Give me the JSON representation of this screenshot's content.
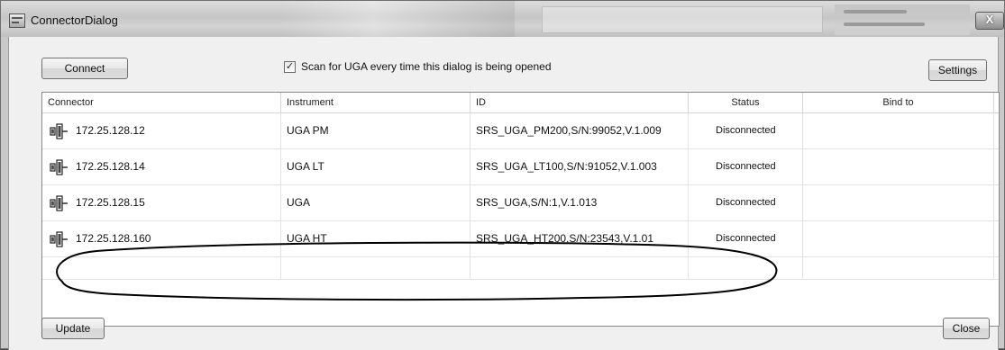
{
  "window": {
    "title": "ConnectorDialog",
    "close_glyph": "X",
    "app_icon": "dialog-app-icon"
  },
  "toolbar": {
    "connect_label": "Connect",
    "scan_checkbox_checked": true,
    "scan_label": "Scan for UGA every time this dialog is being opened",
    "settings_label": "Settings"
  },
  "table": {
    "columns": [
      "Connector",
      "Instrument",
      "ID",
      "Status",
      "Bind to"
    ],
    "rows": [
      {
        "connector": "172.25.128.12",
        "instrument": "UGA PM",
        "id": "SRS_UGA_PM200,S/N:99052,V.1.009",
        "status": "Disconnected",
        "bind_to": ""
      },
      {
        "connector": "172.25.128.14",
        "instrument": "UGA LT",
        "id": "SRS_UGA_LT100,S/N:91052,V.1.003",
        "status": "Disconnected",
        "bind_to": ""
      },
      {
        "connector": "172.25.128.15",
        "instrument": "UGA",
        "id": "SRS_UGA,S/N:1,V.1.013",
        "status": "Disconnected",
        "bind_to": ""
      },
      {
        "connector": "172.25.128.160",
        "instrument": "UGA HT",
        "id": "SRS_UGA_HT200,S/N:23543,V.1.01",
        "status": "Disconnected",
        "bind_to": ""
      }
    ],
    "row_icon": "network-connector-icon"
  },
  "footer": {
    "update_label": "Update",
    "close_label": "Close"
  },
  "colors": {
    "client_bg": "#f0f0f0",
    "grid_bg": "#ffffff",
    "annotation_ellipse": "#000000"
  }
}
